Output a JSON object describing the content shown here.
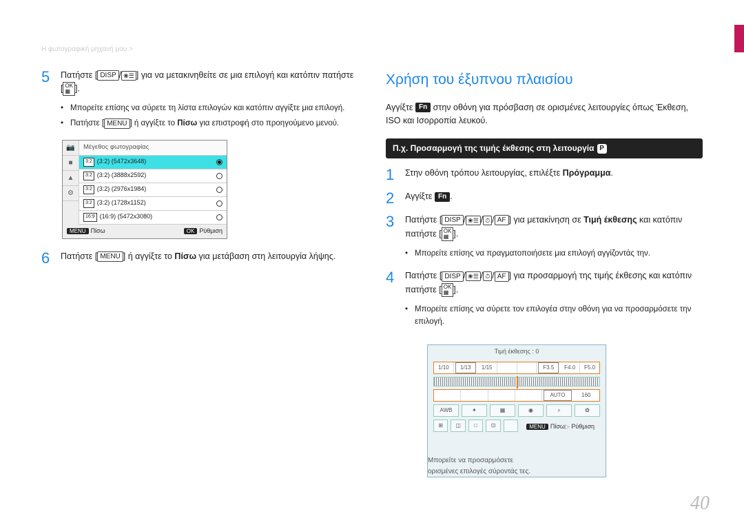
{
  "breadcrumb": "Η φωτογραφική μηχανή μου >",
  "page_number": "40",
  "left": {
    "step5": {
      "pre": "Πατήστε [",
      "disp": "DISP",
      "mid": "/",
      "post": "] για να μετακινηθείτε σε μια επιλογή και κατόπιν πατήστε [",
      "end": "]."
    },
    "step5_bullets": [
      "Μπορείτε επίσης να σύρετε τη λίστα επιλογών και κατόπιν αγγίξτε μια επιλογή.",
      "Πατήστε [MENU] ή αγγίξτε το Πίσω για επιστροφή στο προηγούμενο μενού."
    ],
    "cam_menu": {
      "title": "Μέγεθος φωτογραφίας",
      "rows": [
        {
          "ratio": "3:2",
          "res": "(3:2) (5472x3648)",
          "sel": true
        },
        {
          "ratio": "3:2",
          "res": "(3:2) (3888x2592)",
          "sel": false
        },
        {
          "ratio": "3:2",
          "res": "(3:2) (2976x1984)",
          "sel": false
        },
        {
          "ratio": "3:2",
          "res": "(3:2) (1728x1152)",
          "sel": false
        },
        {
          "ratio": "16:9",
          "res": "(16:9) (5472x3080)",
          "sel": false
        }
      ],
      "back": "Πίσω",
      "set": "Ρύθμιση",
      "menu": "MENU",
      "ok": "OK"
    },
    "step6": {
      "pre": "Πατήστε [",
      "menu": "MENU",
      "mid": "] ή αγγίξτε το ",
      "back": "Πίσω",
      "post": " για μετάβαση στη λειτουργία λήψης."
    }
  },
  "right": {
    "title": "Χρήση του έξυπνου πλαισίου",
    "intro_pre": "Αγγίξτε ",
    "intro_fn": "Fn",
    "intro_post": " στην οθόνη για πρόσβαση σε ορισμένες λειτουργίες όπως Έκθεση, ISO και Ισορροπία λευκού.",
    "banner_pre": "Π.χ. Προσαρμογή της τιμής έκθεσης στη λειτουργία ",
    "banner_mode": "P",
    "step1": {
      "pre": "Στην οθόνη τρόπου λειτουργίας, επιλέξτε ",
      "bold": "Πρόγραμμα",
      "post": "."
    },
    "step2": {
      "pre": "Αγγίξτε ",
      "fn": "Fn",
      "post": "."
    },
    "step3": {
      "pre": "Πατήστε [",
      "disp": "DISP",
      "mid": "/",
      "af": "AF",
      "mid2": "] για μετακίνηση σε ",
      "bold": "Τιμή έκθεσης",
      "post": " και κατόπιν πατήστε [",
      "end": "]."
    },
    "step3_bullet": "Μπορείτε επίσης να πραγματοποιήσετε μια επιλογή αγγίζοντάς την.",
    "step4": {
      "pre": "Πατήστε [",
      "disp": "DISP",
      "mid": "/",
      "af": "AF",
      "post": "] για προσαρμογή της τιμής έκθεσης και κατόπιν πατήστε [",
      "end": "]."
    },
    "step4_bullet": "Μπορείτε επίσης να σύρετε τον επιλογέα στην οθόνη για να προσαρμόσετε την επιλογή.",
    "exposure": {
      "title": "Τιμή έκθεσης : 0",
      "row1": [
        "1/10",
        "1/13",
        "1/15",
        "",
        "",
        "F3.5",
        "F4.0",
        "F5.0"
      ],
      "row2": [
        "",
        "",
        "",
        "",
        "AUTO",
        "160"
      ],
      "btns": [
        "AWB",
        "✦",
        "▦",
        "◉",
        "⌕",
        "✿"
      ],
      "btns2": [
        "⊞",
        "◫",
        "□",
        "⊡",
        "",
        ""
      ],
      "back": "Πίσω",
      "menu": "MENU",
      "set": "Ρύθμιση"
    },
    "callout": "Μπορείτε να προσαρμόσετε ορισμένες επιλογές σύροντάς τες."
  }
}
